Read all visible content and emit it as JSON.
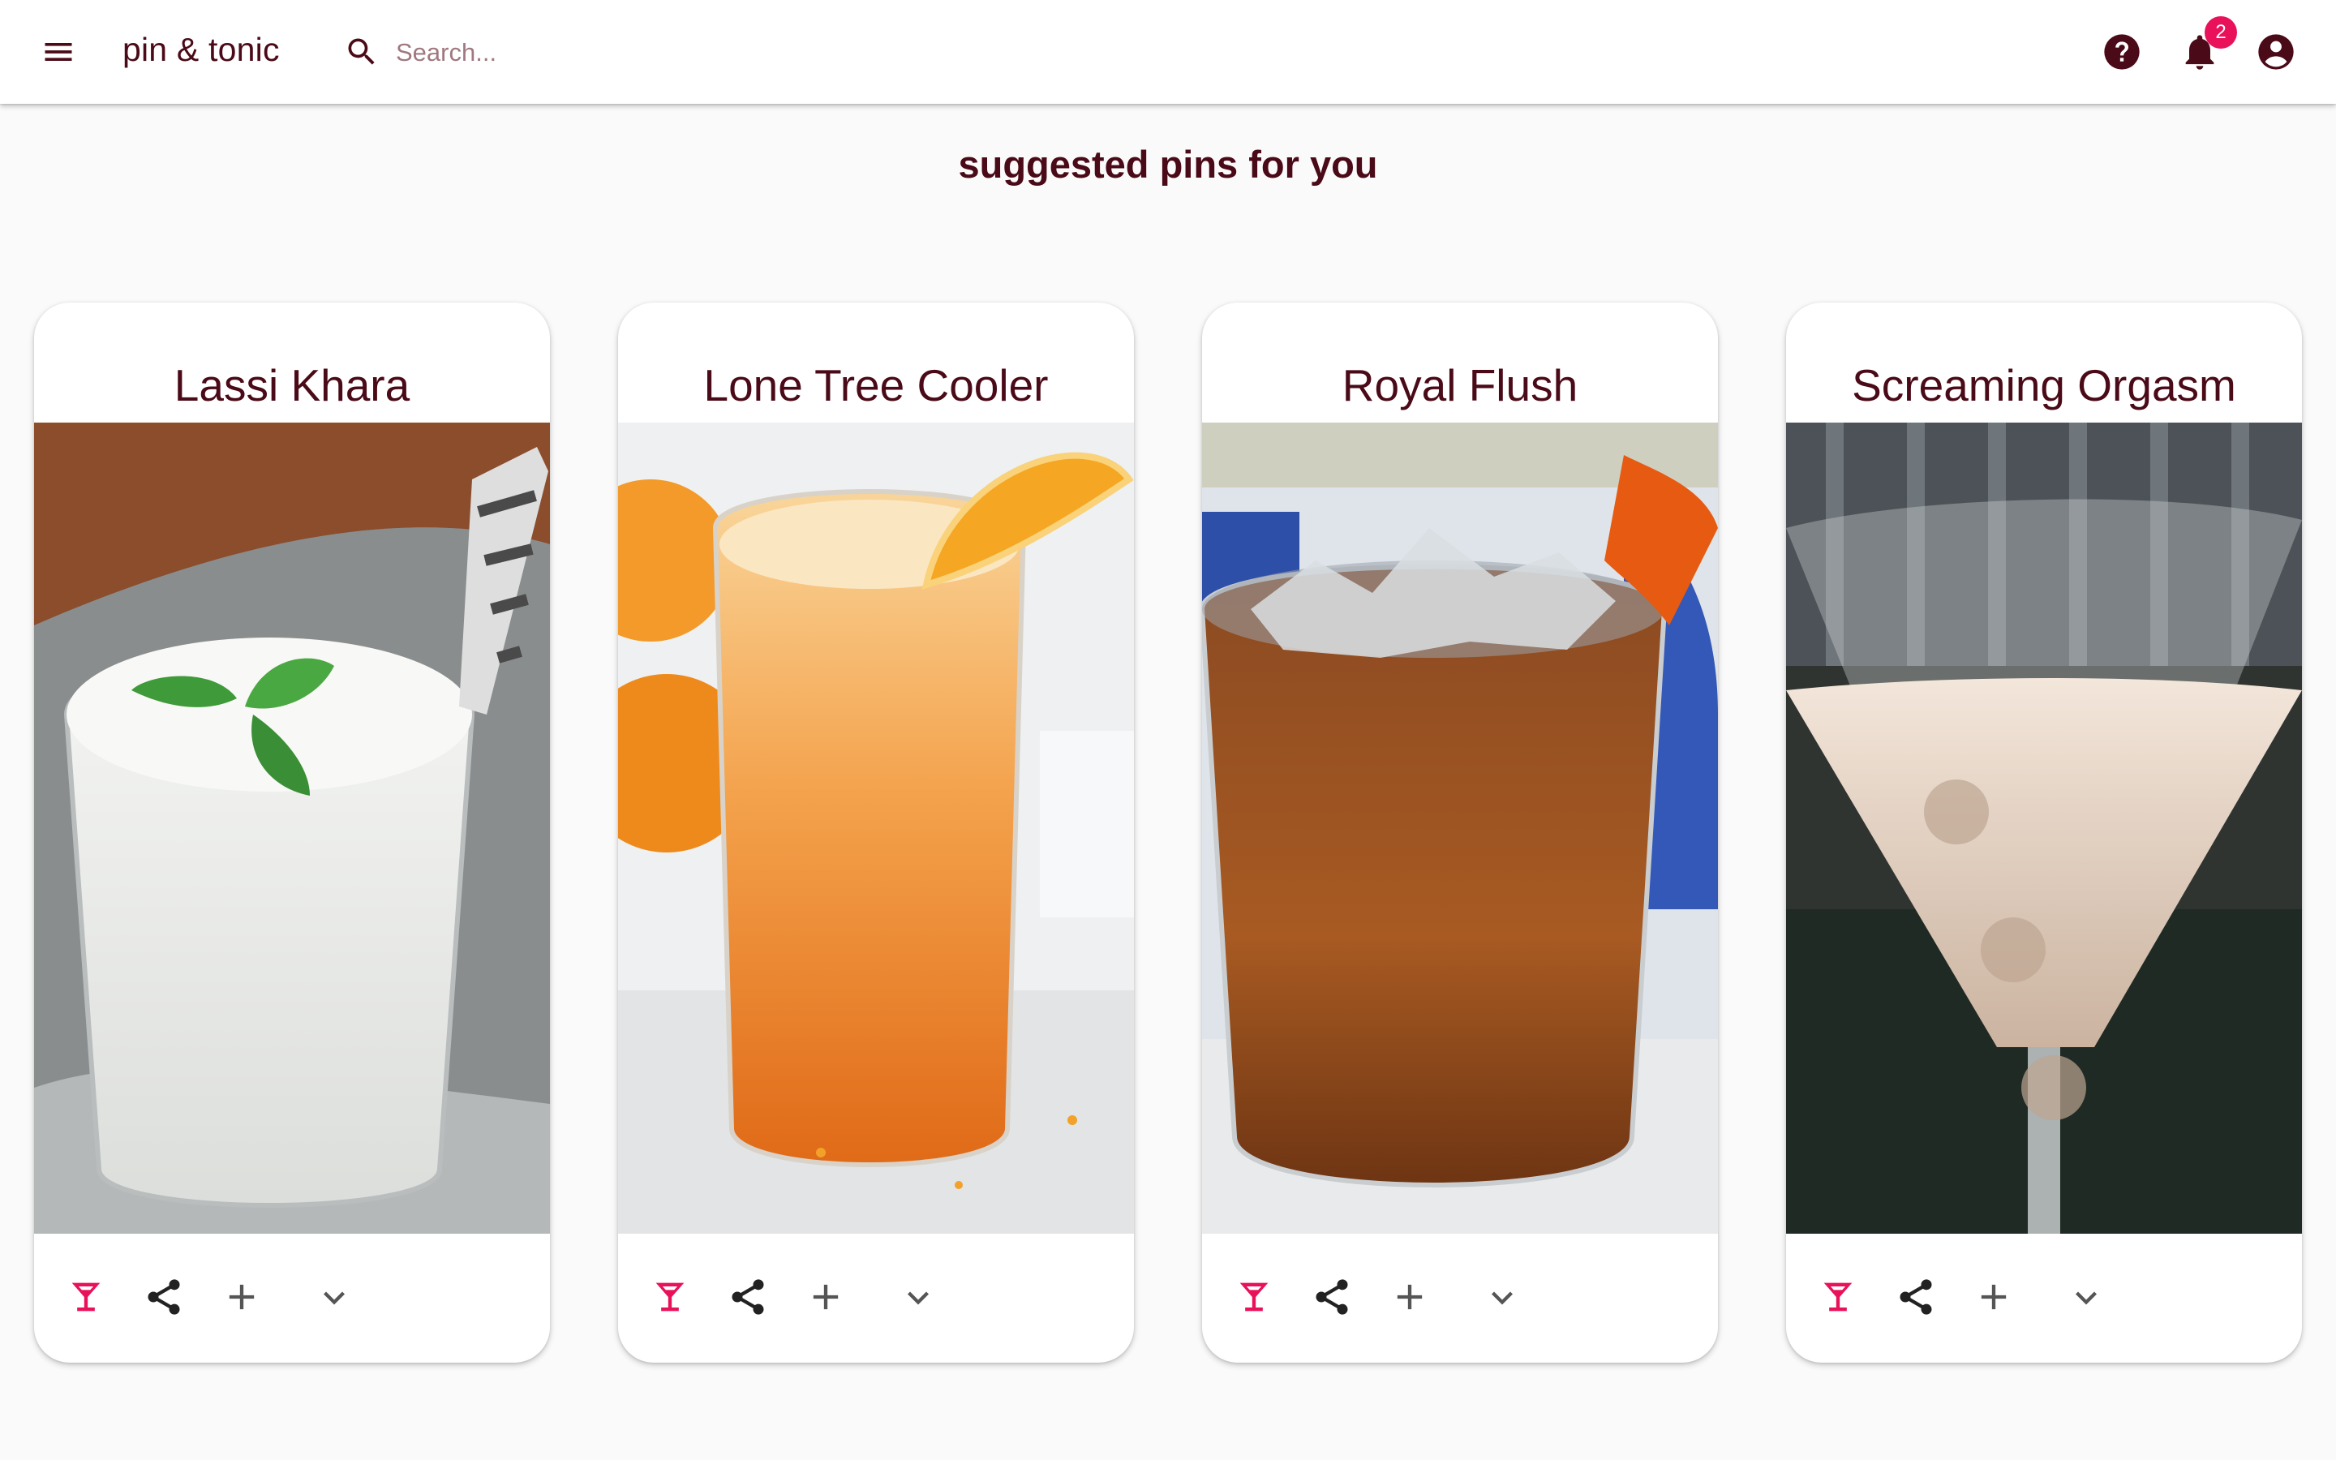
{
  "app": {
    "title": "pin & tonic",
    "search_placeholder": "Search...",
    "notification_count": "2",
    "icons": {
      "menu": "menu-icon",
      "search": "search-icon",
      "help": "help-icon",
      "notifications": "bell-icon",
      "account": "account-circle-icon"
    }
  },
  "page": {
    "heading": "suggested pins for you"
  },
  "cards": [
    {
      "title": "Lassi Khara"
    },
    {
      "title": "Lone Tree Cooler"
    },
    {
      "title": "Royal Flush"
    },
    {
      "title": "Screaming Orgasm"
    }
  ],
  "card_actions": [
    "cocktail-icon",
    "share-icon",
    "add-icon",
    "chevron-down-icon"
  ],
  "colors": {
    "brand": "#4a0a17",
    "accent": "#e8115a",
    "background": "#fafafa",
    "surface": "#ffffff"
  }
}
